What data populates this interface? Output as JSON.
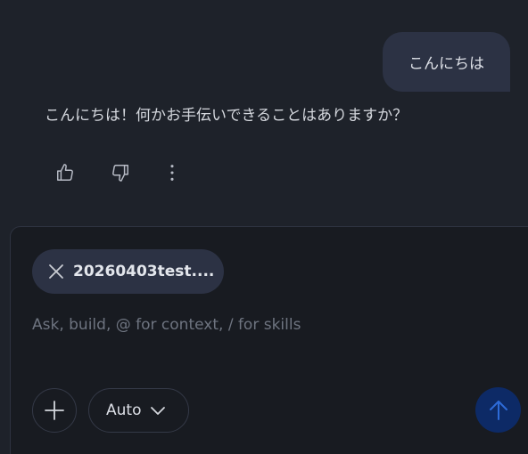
{
  "conversation": {
    "user_message": "こんにちは",
    "assistant_message": "こんにちは！何かお手伝いできることはありますか？",
    "actions": [
      {
        "icon": "thumbs-up-icon"
      },
      {
        "icon": "thumbs-down-icon"
      },
      {
        "icon": "more-vertical-icon"
      }
    ]
  },
  "composer": {
    "attachment": {
      "label": "20260403test....",
      "remove_icon": "close-icon"
    },
    "placeholder": "Ask, build, @ for context, / for skills",
    "value": "",
    "add_icon": "plus-icon",
    "model": {
      "label": "Auto",
      "icon": "chevron-down-icon"
    },
    "send_icon": "arrow-up-icon"
  },
  "colors": {
    "background": "#1e222a",
    "bubble": "#2c3244",
    "composer": "#181b21",
    "send_button": "#0d2a66",
    "send_arrow": "#2d6bd8"
  }
}
